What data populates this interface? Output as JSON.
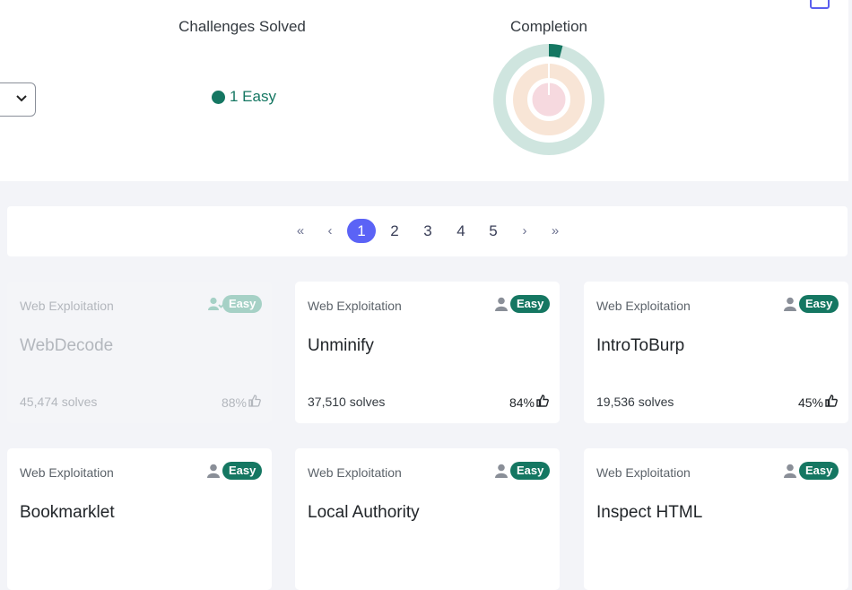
{
  "stats": {
    "solved_title": "Challenges Solved",
    "completion_title": "Completion",
    "legend": [
      {
        "label": "1 Easy",
        "color": "#157762"
      }
    ],
    "completion_fraction": 0.04
  },
  "pagination": {
    "first": "«",
    "prev": "‹",
    "pages": [
      "1",
      "2",
      "3",
      "4",
      "5"
    ],
    "active_page": "1",
    "next": "›",
    "last": "»"
  },
  "colors": {
    "accent": "#5b63f6",
    "easy": "#157762",
    "easy_faded": "#a6d1c6"
  },
  "cards": [
    {
      "category": "Web Exploitation",
      "difficulty": "Easy",
      "name": "WebDecode",
      "solves": "45,474 solves",
      "rate": "88%",
      "solved": true,
      "user_icon": "user-check-icon"
    },
    {
      "category": "Web Exploitation",
      "difficulty": "Easy",
      "name": "Unminify",
      "solves": "37,510 solves",
      "rate": "84%",
      "solved": false,
      "user_icon": "user-icon"
    },
    {
      "category": "Web Exploitation",
      "difficulty": "Easy",
      "name": "IntroToBurp",
      "solves": "19,536 solves",
      "rate": "45%",
      "solved": false,
      "user_icon": "user-icon"
    },
    {
      "category": "Web Exploitation",
      "difficulty": "Easy",
      "name": "Bookmarklet",
      "solved": false,
      "user_icon": "user-icon"
    },
    {
      "category": "Web Exploitation",
      "difficulty": "Easy",
      "name": "Local Authority",
      "solved": false,
      "user_icon": "user-icon"
    },
    {
      "category": "Web Exploitation",
      "difficulty": "Easy",
      "name": "Inspect HTML",
      "solved": false,
      "user_icon": "user-icon"
    }
  ]
}
